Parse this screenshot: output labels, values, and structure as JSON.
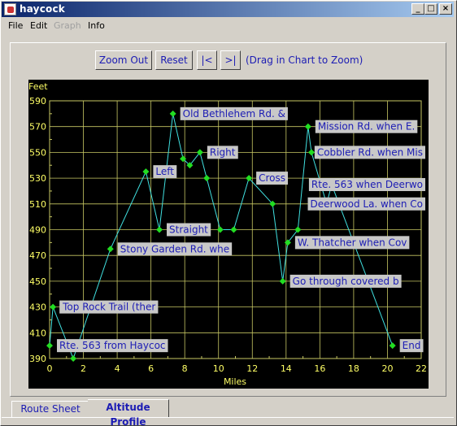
{
  "window": {
    "title": "haycock"
  },
  "menubar": {
    "items": [
      {
        "label": "File",
        "disabled": false
      },
      {
        "label": "Edit",
        "disabled": false
      },
      {
        "label": "Graph",
        "disabled": true
      },
      {
        "label": "Info",
        "disabled": false
      }
    ]
  },
  "toolbar": {
    "zoom_out_label": "Zoom Out",
    "reset_label": "Reset",
    "first_label": "|<",
    "last_label": ">|",
    "hint": "(Drag in Chart to Zoom)"
  },
  "tabs": [
    {
      "label": "Route Sheet",
      "active": false
    },
    {
      "label": "Altitude Profile",
      "active": true
    }
  ],
  "colors": {
    "background": "#000000",
    "grid": "#c8c864",
    "axis_text": "#ffff66",
    "line": "#40e0e0",
    "point": "#22dd22",
    "label_bg": "#c8c8c8",
    "label_text": "#1c1cb4"
  },
  "chart_data": {
    "type": "line",
    "ylabel": "Feet",
    "xlabel": "Miles",
    "xlim": [
      0,
      22
    ],
    "ylim": [
      390,
      590
    ],
    "xticks": [
      0,
      2,
      4,
      6,
      8,
      10,
      12,
      14,
      16,
      18,
      20,
      22
    ],
    "yticks": [
      390,
      410,
      430,
      450,
      470,
      490,
      510,
      530,
      550,
      570,
      590
    ],
    "grid": true,
    "series": [
      {
        "points": [
          {
            "x": 0.0,
            "y": 400,
            "label": "Rte. 563 from Haycoc"
          },
          {
            "x": 0.2,
            "y": 430,
            "label": "Top Rock Trail (ther"
          },
          {
            "x": 1.4,
            "y": 390,
            "label": ""
          },
          {
            "x": 3.6,
            "y": 475,
            "label": "Stony Garden Rd. whe"
          },
          {
            "x": 5.7,
            "y": 535,
            "label": "Left"
          },
          {
            "x": 6.5,
            "y": 490,
            "label": "Straight"
          },
          {
            "x": 7.3,
            "y": 580,
            "label": "Old Bethlehem Rd. &"
          },
          {
            "x": 7.9,
            "y": 545,
            "label": ""
          },
          {
            "x": 8.3,
            "y": 540,
            "label": ""
          },
          {
            "x": 8.9,
            "y": 550,
            "label": "Right"
          },
          {
            "x": 9.3,
            "y": 530,
            "label": ""
          },
          {
            "x": 10.1,
            "y": 490,
            "label": ""
          },
          {
            "x": 10.9,
            "y": 490,
            "label": ""
          },
          {
            "x": 11.8,
            "y": 530,
            "label": "Cross"
          },
          {
            "x": 13.2,
            "y": 510,
            "label": ""
          },
          {
            "x": 13.8,
            "y": 450,
            "label": "Go through covered b"
          },
          {
            "x": 14.1,
            "y": 480,
            "label": "W. Thatcher when Cov"
          },
          {
            "x": 14.7,
            "y": 490,
            "label": ""
          },
          {
            "x": 15.3,
            "y": 570,
            "label": "Mission Rd. when E."
          },
          {
            "x": 15.5,
            "y": 550,
            "label": "Cobbler Rd. when Mis"
          },
          {
            "x": 16.4,
            "y": 510,
            "label": "Deerwood La. when Co"
          },
          {
            "x": 16.7,
            "y": 525,
            "label": "Rte. 563 when Deerwo"
          },
          {
            "x": 20.3,
            "y": 400,
            "label": "End"
          }
        ]
      }
    ]
  }
}
